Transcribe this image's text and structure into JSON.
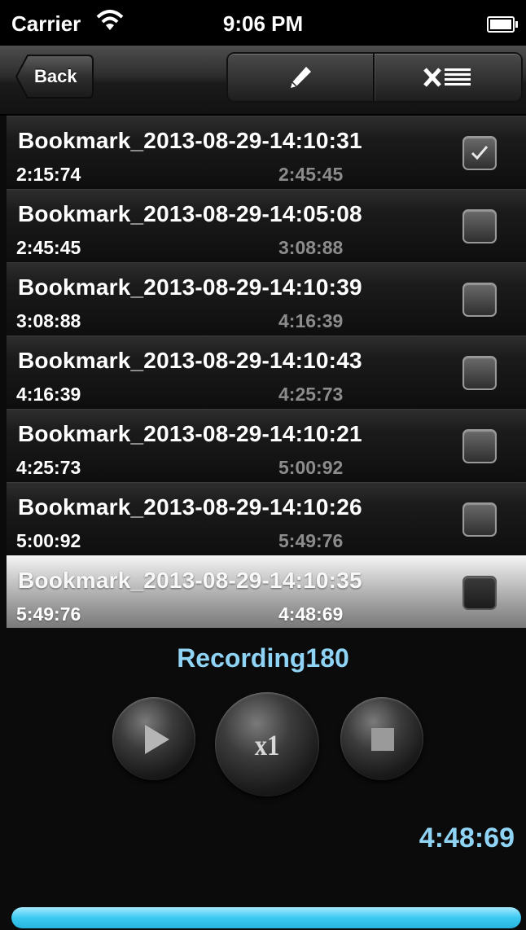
{
  "status_bar": {
    "carrier": "Carrier",
    "time": "9:06 PM",
    "wifi_icon": "wifi-icon",
    "battery_icon": "battery-icon"
  },
  "nav": {
    "back_label": "Back",
    "edit_icon": "pencil-icon",
    "clear_icon": "clear-list-icon"
  },
  "bookmarks": [
    {
      "title": "Bookmark_2013-08-29-14:10:31",
      "start": "2:15:74",
      "end": "2:45:45",
      "checked": true
    },
    {
      "title": "Bookmark_2013-08-29-14:05:08",
      "start": "2:45:45",
      "end": "3:08:88",
      "checked": false
    },
    {
      "title": "Bookmark_2013-08-29-14:10:39",
      "start": "3:08:88",
      "end": "4:16:39",
      "checked": false
    },
    {
      "title": "Bookmark_2013-08-29-14:10:43",
      "start": "4:16:39",
      "end": "4:25:73",
      "checked": false
    },
    {
      "title": "Bookmark_2013-08-29-14:10:21",
      "start": "4:25:73",
      "end": "5:00:92",
      "checked": false
    },
    {
      "title": "Bookmark_2013-08-29-14:10:26",
      "start": "5:00:92",
      "end": "5:49:76",
      "checked": false
    },
    {
      "title": "Bookmark_2013-08-29-14:10:35",
      "start": "5:49:76",
      "end": "4:48:69",
      "checked": false,
      "selected": true
    }
  ],
  "player": {
    "recording_name": "Recording180",
    "speed_label": "x1",
    "elapsed": "4:48:69",
    "progress": 1.0,
    "play_icon": "play-icon",
    "stop_icon": "stop-icon"
  },
  "colors": {
    "accent": "#8fd3f5",
    "progress": "#3cc9f2"
  }
}
